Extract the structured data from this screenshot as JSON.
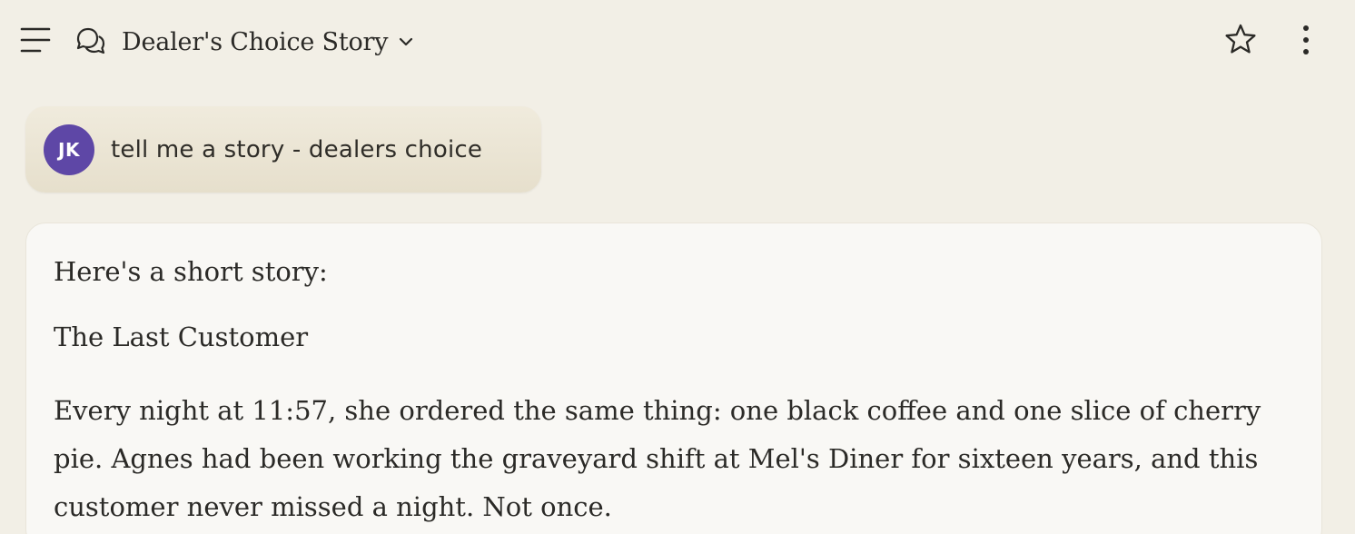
{
  "header": {
    "title": "Dealer's Choice Story",
    "icons": {
      "menu": "hamburger-icon",
      "chat": "chat-bubbles-icon",
      "dropdown": "chevron-down-icon",
      "star": "star-icon",
      "more": "vertical-dots-icon"
    }
  },
  "user_message": {
    "avatar_initials": "JK",
    "avatar_color": "#5e47a6",
    "text": "tell me a story - dealers choice"
  },
  "assistant_message": {
    "intro": "Here's a short story:",
    "story_title": "The Last Customer",
    "paragraph": "Every night at 11:57, she ordered the same thing: one black coffee and one slice of cherry pie. Agnes had been working the graveyard shift at Mel's Diner for sixteen years, and this customer never missed a night. Not once."
  },
  "colors": {
    "background": "#f2efe6",
    "card": "#f9f8f5",
    "text": "#2b2a27"
  }
}
